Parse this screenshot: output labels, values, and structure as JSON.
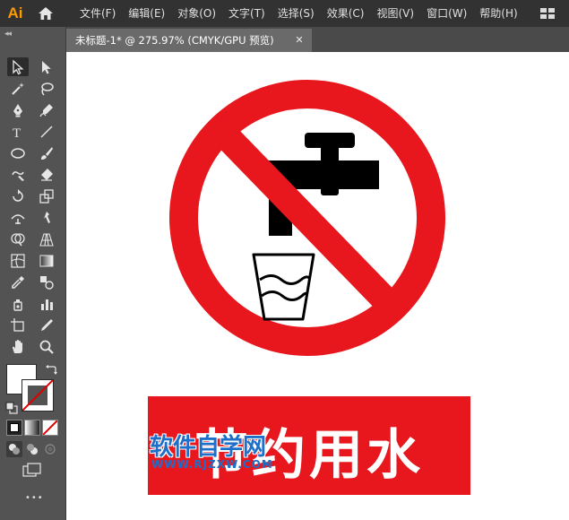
{
  "app": {
    "logo": "Ai",
    "home_icon": "home-icon",
    "workspace_icon": "workspace-grid-icon"
  },
  "menus": [
    "文件(F)",
    "编辑(E)",
    "对象(O)",
    "文字(T)",
    "选择(S)",
    "效果(C)",
    "视图(V)",
    "窗口(W)",
    "帮助(H)"
  ],
  "toolbar": {
    "collapse_glyph": "◂◂",
    "tools": [
      "selection-icon",
      "direct-selection-icon",
      "magic-wand-icon",
      "lasso-icon",
      "pen-icon",
      "curvature-icon",
      "type-icon",
      "line-segment-icon",
      "ellipse-icon",
      "paintbrush-icon",
      "shaper-icon",
      "eraser-icon",
      "rotate-icon",
      "scale-icon",
      "width-icon",
      "puppet-warp-icon",
      "shape-builder-icon",
      "perspective-grid-icon",
      "mesh-icon",
      "gradient-icon",
      "eyedropper-icon",
      "blend-icon",
      "symbol-sprayer-icon",
      "column-graph-icon",
      "artboard-icon",
      "slice-icon",
      "hand-icon",
      "zoom-icon"
    ],
    "more_glyph": "•••"
  },
  "document": {
    "tab_title": "未标题-1* @ 275.97% (CMYK/GPU 预览)",
    "close_glyph": "✕"
  },
  "artwork": {
    "sign_color": "#e8161d",
    "banner_text": "节约用水",
    "watermark_main": "软件自学网",
    "watermark_sub": "WWW.RJZXW.COM"
  }
}
